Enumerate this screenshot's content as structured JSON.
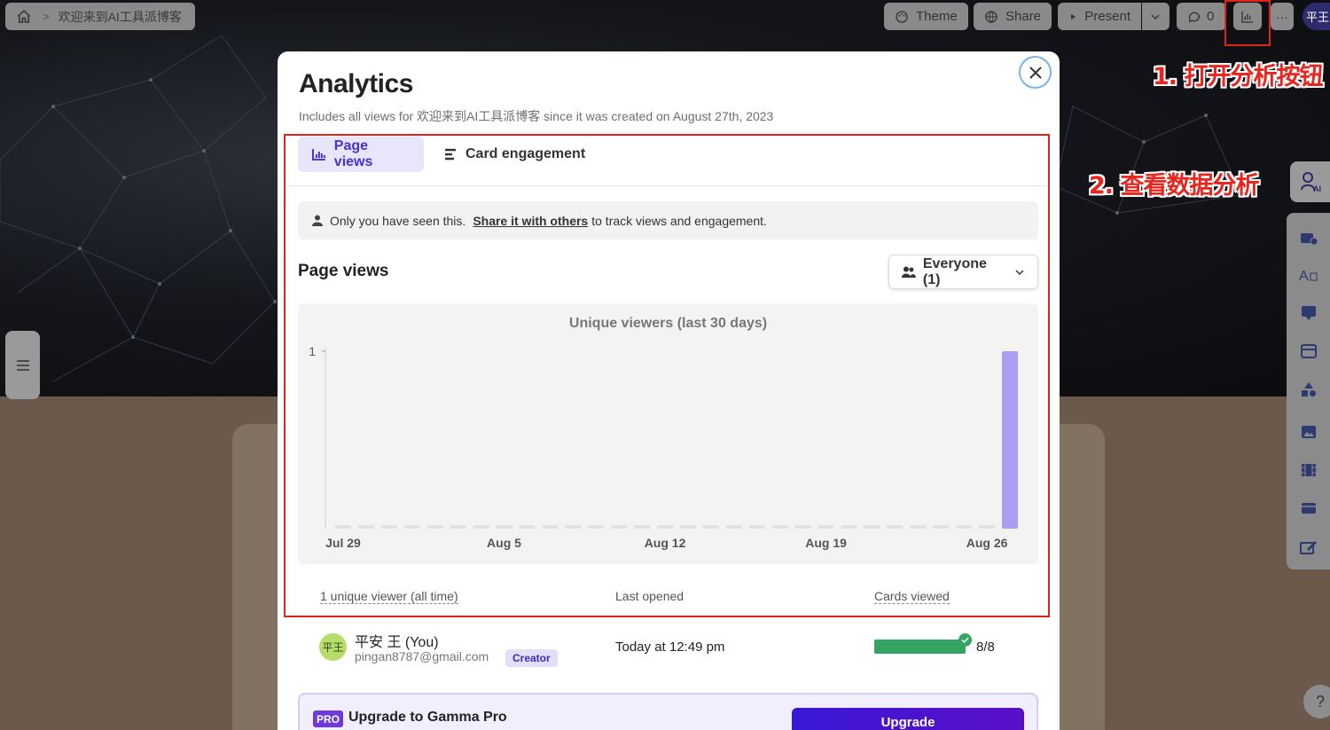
{
  "topbar": {
    "breadcrumb": "欢迎来到AI工具派博客",
    "theme_label": "Theme",
    "share_label": "Share",
    "present_label": "Present",
    "comments_count": "0",
    "avatar_initials": "平王"
  },
  "annotations": {
    "step1": "1. 打开分析按钮",
    "step2": "2. 查看数据分析"
  },
  "modal": {
    "title": "Analytics",
    "subtitle": "Includes all views for 欢迎来到AI工具派博客 since it was created on August 27th, 2023",
    "tabs": [
      {
        "label": "Page views",
        "active": true
      },
      {
        "label": "Card engagement",
        "active": false
      }
    ],
    "notice": {
      "prefix": "Only you have seen this.",
      "link": "Share it with others",
      "suffix": "to track views and engagement."
    },
    "section_title": "Page views",
    "audience_filter": "Everyone (1)",
    "table_headers": {
      "viewers": "1 unique viewer (all time)",
      "last_opened": "Last opened",
      "cards_viewed": "Cards viewed"
    },
    "viewer": {
      "initials": "平王",
      "name": "平安 王 (You)",
      "email": "pingan8787@gmail.com",
      "role": "Creator",
      "last_opened": "Today at 12:49 pm",
      "cards_viewed": "8/8",
      "progress": 1.0
    },
    "upgrade": {
      "tag": "PRO",
      "text": "Upgrade to Gamma Pro",
      "button": "Upgrade"
    }
  },
  "colors": {
    "accent": "#4a2fd3",
    "bar": "#a99ef4",
    "progress": "#34a462",
    "annotation": "#e8251e"
  },
  "chart_data": {
    "type": "bar",
    "title": "Unique viewers (last 30 days)",
    "x": [
      "Jul 29",
      "Jul 30",
      "Jul 31",
      "Aug 1",
      "Aug 2",
      "Aug 3",
      "Aug 4",
      "Aug 5",
      "Aug 6",
      "Aug 7",
      "Aug 8",
      "Aug 9",
      "Aug 10",
      "Aug 11",
      "Aug 12",
      "Aug 13",
      "Aug 14",
      "Aug 15",
      "Aug 16",
      "Aug 17",
      "Aug 18",
      "Aug 19",
      "Aug 20",
      "Aug 21",
      "Aug 22",
      "Aug 23",
      "Aug 24",
      "Aug 25",
      "Aug 26",
      "Aug 27"
    ],
    "values": [
      0,
      0,
      0,
      0,
      0,
      0,
      0,
      0,
      0,
      0,
      0,
      0,
      0,
      0,
      0,
      0,
      0,
      0,
      0,
      0,
      0,
      0,
      0,
      0,
      0,
      0,
      0,
      0,
      0,
      1
    ],
    "xtick_labels": [
      "Jul 29",
      "Aug 5",
      "Aug 12",
      "Aug 19",
      "Aug 26"
    ],
    "ylim": [
      0,
      1
    ],
    "yticks": [
      1
    ],
    "grid": false
  }
}
